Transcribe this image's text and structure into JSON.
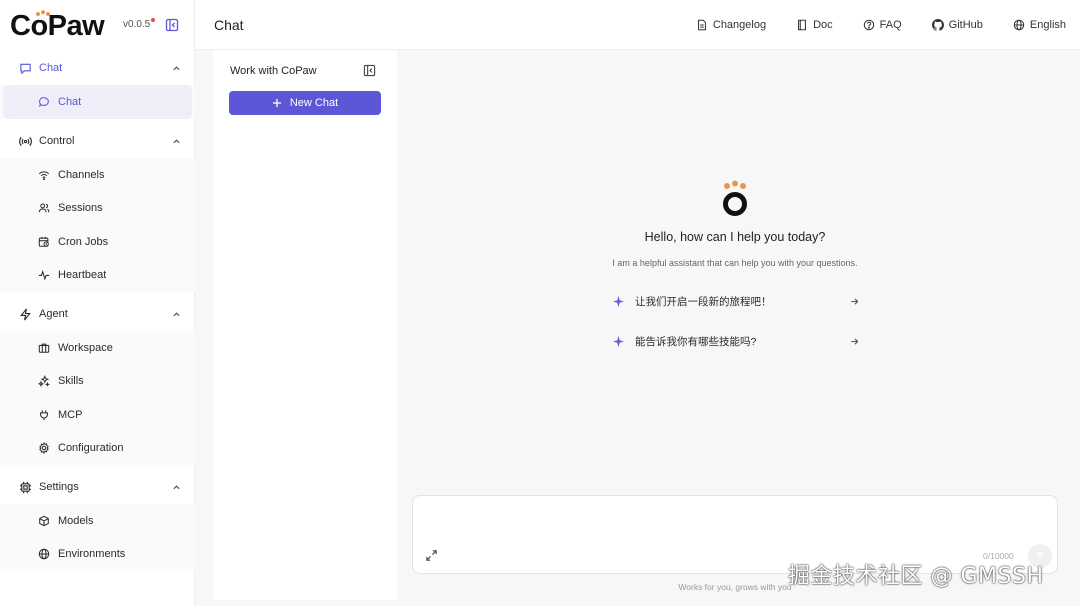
{
  "brand": {
    "name": "CoPaw",
    "version": "v0.0.5"
  },
  "sidebar": {
    "groups": [
      {
        "label": "Chat",
        "icon": "chat-bubble-icon",
        "items": [
          {
            "label": "Chat",
            "icon": "chat-bubble-icon"
          }
        ]
      },
      {
        "label": "Control",
        "icon": "broadcast-icon",
        "items": [
          {
            "label": "Channels",
            "icon": "wifi-icon"
          },
          {
            "label": "Sessions",
            "icon": "users-icon"
          },
          {
            "label": "Cron Jobs",
            "icon": "calendar-clock-icon"
          },
          {
            "label": "Heartbeat",
            "icon": "pulse-icon"
          }
        ]
      },
      {
        "label": "Agent",
        "icon": "zap-icon",
        "items": [
          {
            "label": "Workspace",
            "icon": "briefcase-icon"
          },
          {
            "label": "Skills",
            "icon": "sparkles-icon"
          },
          {
            "label": "MCP",
            "icon": "plug-icon"
          },
          {
            "label": "Configuration",
            "icon": "gear-icon"
          }
        ]
      },
      {
        "label": "Settings",
        "icon": "chip-icon",
        "items": [
          {
            "label": "Models",
            "icon": "cube-icon"
          },
          {
            "label": "Environments",
            "icon": "globe-icon"
          }
        ]
      }
    ]
  },
  "header": {
    "title": "Chat",
    "links": [
      {
        "label": "Changelog",
        "icon": "document-icon"
      },
      {
        "label": "Doc",
        "icon": "book-icon"
      },
      {
        "label": "FAQ",
        "icon": "help-circle-icon"
      },
      {
        "label": "GitHub",
        "icon": "github-icon"
      },
      {
        "label": "English",
        "icon": "globe-icon"
      }
    ]
  },
  "chat_panel": {
    "title": "Work with CoPaw",
    "new_chat_label": "New Chat"
  },
  "welcome": {
    "title": "Hello, how can I help you today?",
    "subtitle": "I am a helpful assistant that can help you with your questions.",
    "prompts": [
      "让我们开启一段新的旅程吧！",
      "能告诉我你有哪些技能吗?"
    ]
  },
  "composer": {
    "value": "",
    "placeholder": "",
    "char_count": "0/10000"
  },
  "footer": {
    "note": "Works for you, grows with you"
  },
  "watermark": "掘金技术社区 @ GMSSH",
  "colors": {
    "accent": "#5b57d6",
    "logo_paw": "#e8964a",
    "status_dot": "#e5484d"
  }
}
